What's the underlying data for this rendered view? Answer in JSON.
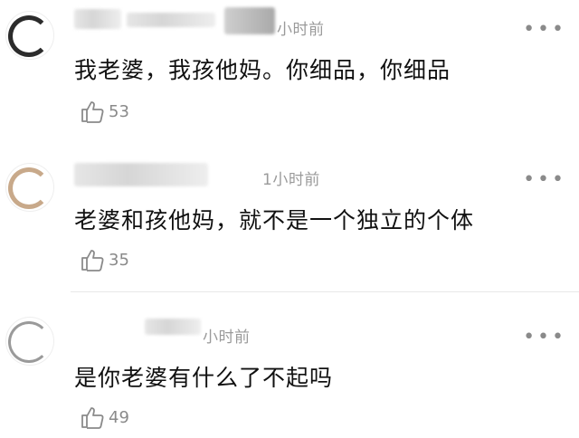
{
  "comments": [
    {
      "time": "小时前",
      "text": "我老婆，我孩他妈。你细品，你细品",
      "likes": "53",
      "avatar_icon": "avatar-icon"
    },
    {
      "time": "1小时前",
      "text": "老婆和孩他妈，就不是一个独立的个体",
      "likes": "35",
      "avatar_icon": "avatar-icon"
    },
    {
      "time": "小时前",
      "text": "是你老婆有什么了不起吗",
      "likes": "49",
      "avatar_icon": "avatar-icon"
    }
  ],
  "more_glyph": "•••"
}
